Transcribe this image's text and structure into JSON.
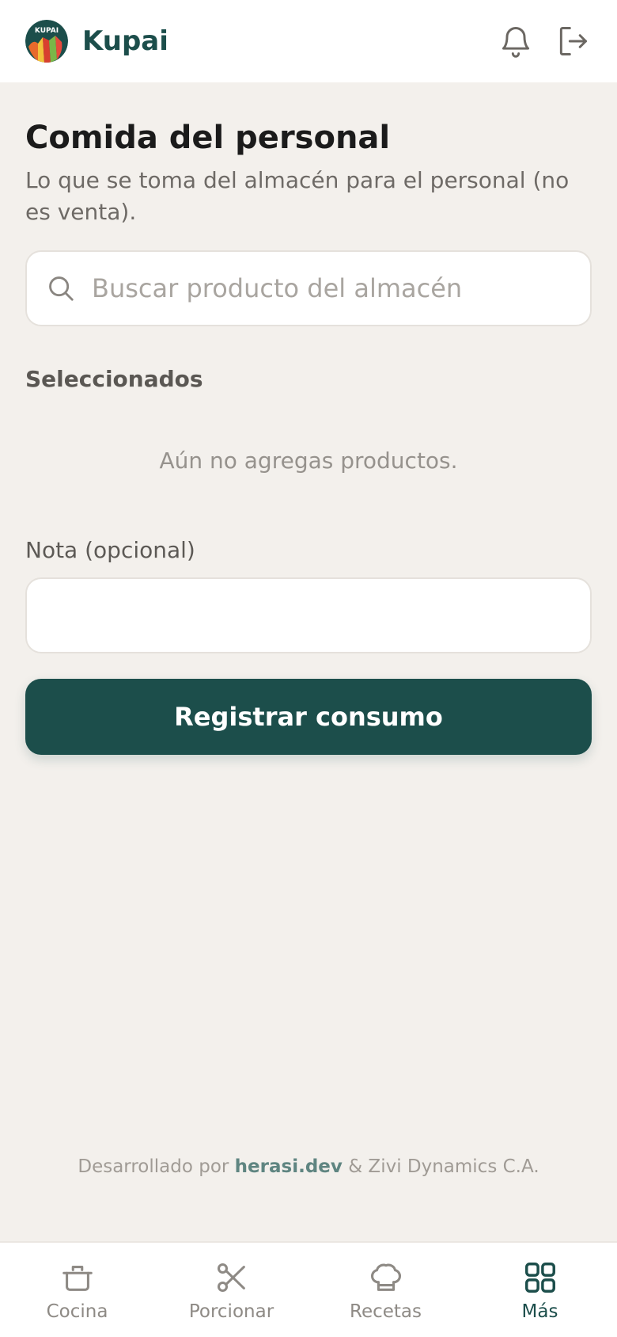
{
  "header": {
    "brand": "Kupai",
    "logo_text": "KUPAI"
  },
  "page": {
    "title": "Comida del personal",
    "subtitle": "Lo que se toma del almacén para el personal (no es venta)."
  },
  "search": {
    "placeholder": "Buscar producto del almacén",
    "value": ""
  },
  "selected": {
    "label": "Seleccionados",
    "empty_message": "Aún no agregas productos."
  },
  "note": {
    "label": "Nota (opcional)",
    "value": ""
  },
  "actions": {
    "submit_label": "Registrar consumo"
  },
  "footer": {
    "prefix": "Desarrollado por",
    "developer": "herasi.dev",
    "suffix": "& Zivi Dynamics C.A."
  },
  "nav": {
    "items": [
      {
        "label": "Cocina",
        "icon": "pot-icon",
        "active": false
      },
      {
        "label": "Porcionar",
        "icon": "scissors-icon",
        "active": false
      },
      {
        "label": "Recetas",
        "icon": "chef-hat-icon",
        "active": false
      },
      {
        "label": "Más",
        "icon": "grid-icon",
        "active": true
      }
    ]
  },
  "colors": {
    "brand": "#1c4e4b",
    "background": "#f3f0ec",
    "muted_text": "#96928d"
  }
}
